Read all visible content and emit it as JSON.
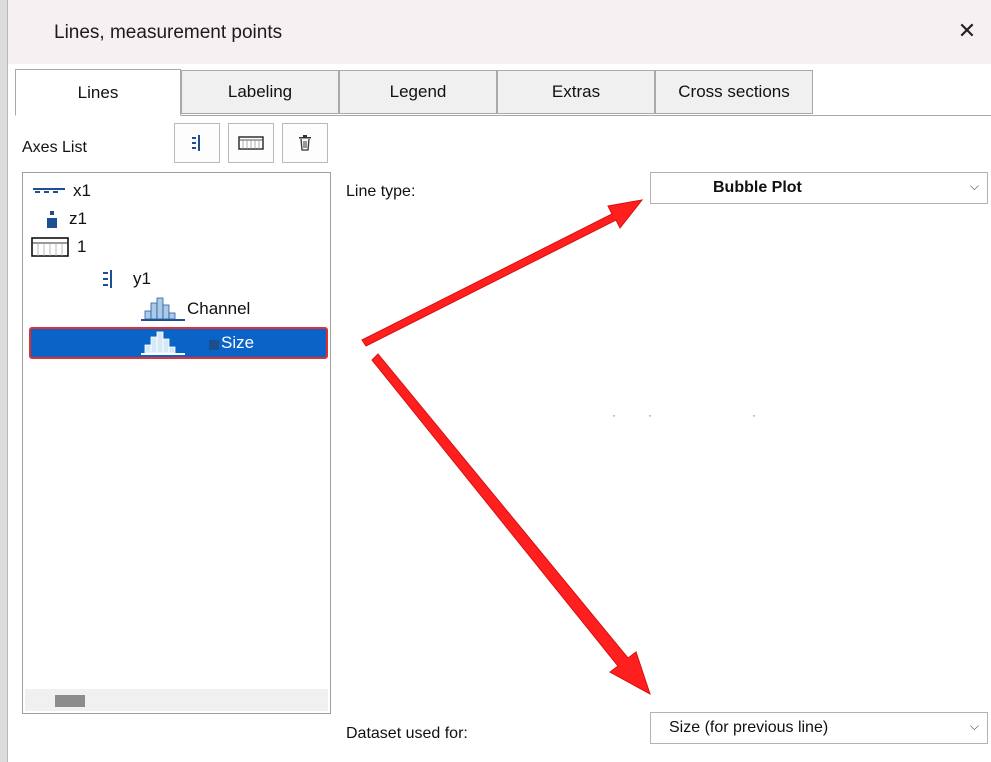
{
  "dialog": {
    "title": "Lines, measurement points",
    "close_glyph": "✕"
  },
  "tabs": [
    {
      "label": "Lines",
      "active": true
    },
    {
      "label": "Labeling",
      "active": false
    },
    {
      "label": "Legend",
      "active": false
    },
    {
      "label": "Extras",
      "active": false
    },
    {
      "label": "Cross sections",
      "active": false
    }
  ],
  "axes_list": {
    "label": "Axes List",
    "toolbar": [
      {
        "icon": "y-axis-icon"
      },
      {
        "icon": "grid-icon"
      },
      {
        "icon": "trash-icon"
      }
    ],
    "tree": [
      {
        "label": "x1",
        "icon": "x-axis-icon"
      },
      {
        "label": "z1",
        "icon": "z-axis-icon"
      },
      {
        "label": "1",
        "icon": "system-box-icon"
      },
      {
        "label": "y1",
        "icon": "y-axis-icon"
      },
      {
        "label": "Channel",
        "icon": "histogram-icon"
      },
      {
        "label": "Size",
        "icon": "histogram-icon",
        "selected": true
      }
    ]
  },
  "line_type": {
    "label": "Line type:",
    "value": "Bubble Plot"
  },
  "dataset": {
    "label": "Dataset used for:",
    "value": "Size (for previous line)"
  },
  "colors": {
    "selection": "#0a64c8",
    "annotation": "#ff2020"
  }
}
